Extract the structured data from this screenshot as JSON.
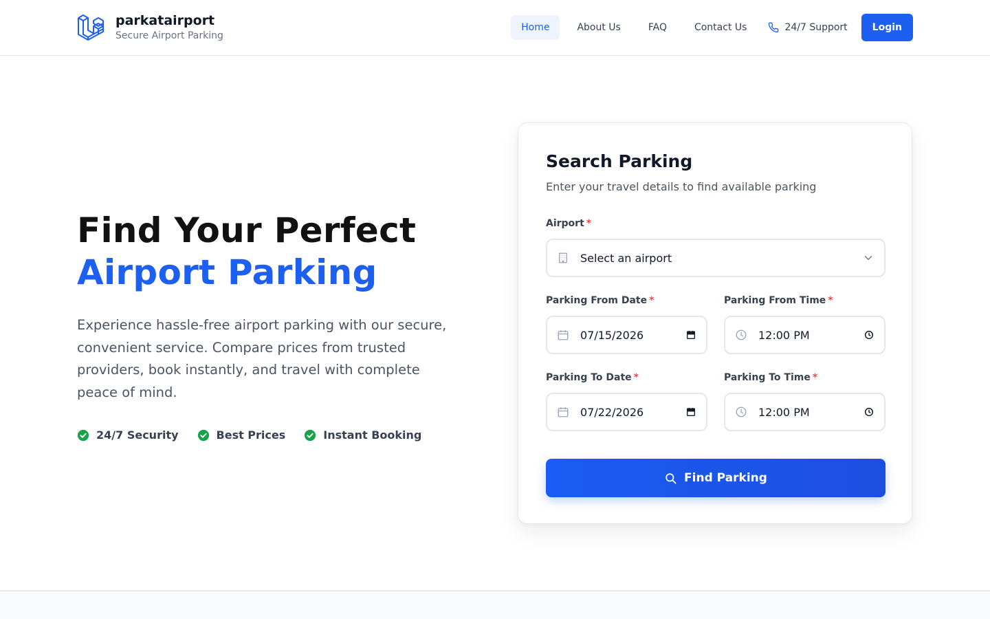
{
  "header": {
    "brand_name": "parkatairport",
    "brand_tagline": "Secure Airport Parking",
    "logo_icon": "laravel-cube-logo",
    "nav": [
      {
        "label": "Home",
        "active": true
      },
      {
        "label": "About Us",
        "active": false
      },
      {
        "label": "FAQ",
        "active": false
      },
      {
        "label": "Contact Us",
        "active": false
      }
    ],
    "support_label": "24/7 Support",
    "support_icon": "phone-icon",
    "login_label": "Login"
  },
  "hero": {
    "title_line1": "Find Your Perfect",
    "title_line2": "Airport Parking",
    "description": "Experience hassle-free airport parking with our secure, convenient service. Compare prices from trusted providers, book instantly, and travel with complete peace of mind.",
    "features": [
      {
        "label": "24/7 Security",
        "icon": "check-circle-icon"
      },
      {
        "label": "Best Prices",
        "icon": "check-circle-icon"
      },
      {
        "label": "Instant Booking",
        "icon": "check-circle-icon"
      }
    ]
  },
  "search": {
    "title": "Search Parking",
    "subtitle": "Enter your travel details to find available parking",
    "required_marker": "*",
    "airport": {
      "label": "Airport",
      "value": "Select an airport",
      "icon": "building-icon"
    },
    "from_date": {
      "label": "Parking From Date",
      "value": "07/15/2026",
      "icon": "calendar-icon"
    },
    "from_time": {
      "label": "Parking From Time",
      "value": "12:00 PM",
      "icon": "clock-icon"
    },
    "to_date": {
      "label": "Parking To Date",
      "value": "07/22/2026",
      "icon": "calendar-icon"
    },
    "to_time": {
      "label": "Parking To Time",
      "value": "12:00 PM",
      "icon": "clock-icon"
    },
    "submit_label": "Find Parking",
    "submit_icon": "search-icon"
  },
  "colors": {
    "accent": "#1d5ff0",
    "success": "#16a34a",
    "required": "#e5484d"
  }
}
